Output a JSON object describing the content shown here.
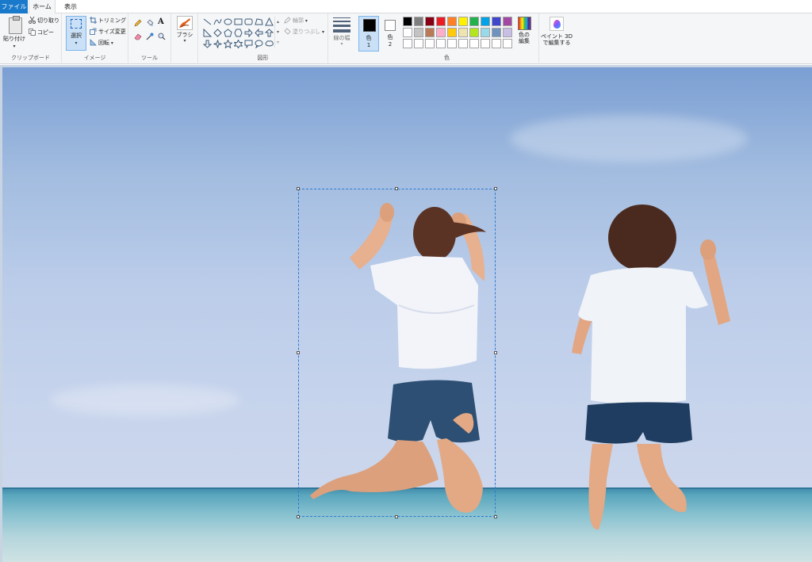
{
  "tabs": {
    "file": "ファイル",
    "home": "ホーム",
    "view": "表示"
  },
  "clipboard": {
    "paste": "貼り付け",
    "cut": "切り取り",
    "copy": "コピー",
    "group": "クリップボード"
  },
  "image": {
    "select": "選択",
    "crop": "トリミング",
    "resize": "サイズ変更",
    "rotate": "回転",
    "group": "イメージ"
  },
  "tools": {
    "group": "ツール",
    "text_tool": "A"
  },
  "brushes": {
    "label": "ブラシ"
  },
  "shapes": {
    "outline": "輪郭",
    "fill": "塗りつぶし",
    "group": "図形"
  },
  "size": {
    "label": "線の幅"
  },
  "colors": {
    "color1_label": "色",
    "color1_num": "1",
    "color2_label": "色",
    "color2_num": "2",
    "edit_label_1": "色の",
    "edit_label_2": "編集",
    "group": "色",
    "color1_value": "#000000",
    "color2_value": "#ffffff",
    "palette_row1": [
      "#000000",
      "#7f7f7f",
      "#880015",
      "#ed1c24",
      "#ff7f27",
      "#fff200",
      "#22b14c",
      "#00a2e8",
      "#3f48cc",
      "#a349a4"
    ],
    "palette_row2": [
      "#ffffff",
      "#c3c3c3",
      "#b97a57",
      "#ffaec9",
      "#ffc90e",
      "#efe4b0",
      "#b5e61d",
      "#99d9ea",
      "#7092be",
      "#c8bfe7"
    ],
    "palette_row3": [
      "#ffffff",
      "#ffffff",
      "#ffffff",
      "#ffffff",
      "#ffffff",
      "#ffffff",
      "#ffffff",
      "#ffffff",
      "#ffffff",
      "#ffffff"
    ]
  },
  "paint3d": {
    "line1": "ペイント 3D",
    "line2": "で編集する"
  }
}
